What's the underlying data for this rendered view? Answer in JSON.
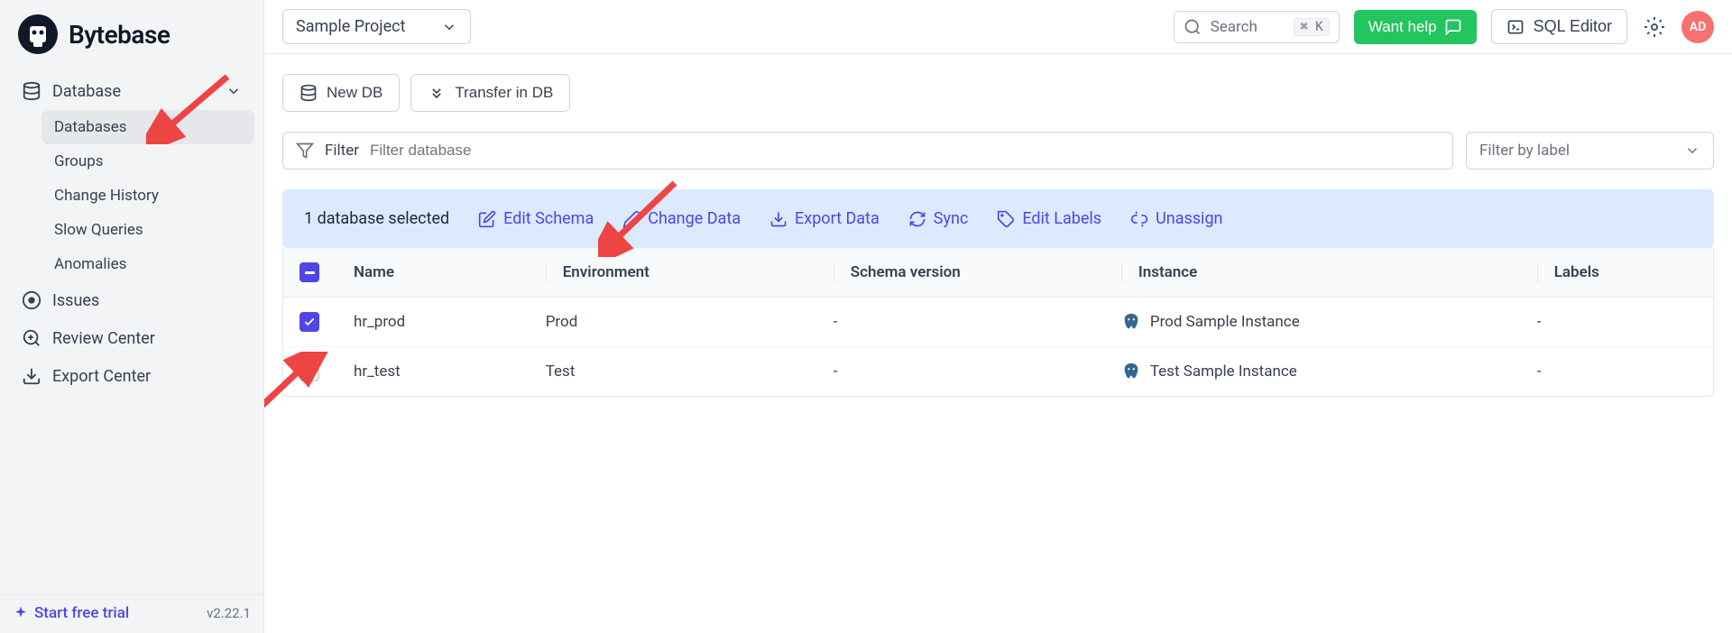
{
  "brand": "Bytebase",
  "sidebar": {
    "database_group": "Database",
    "items": [
      "Databases",
      "Groups",
      "Change History",
      "Slow Queries",
      "Anomalies"
    ],
    "issues": "Issues",
    "review_center": "Review Center",
    "export_center": "Export Center"
  },
  "footer": {
    "trial": "Start free trial",
    "version": "v2.22.1"
  },
  "topbar": {
    "project": "Sample Project",
    "search_placeholder": "Search",
    "search_kbd": "⌘ K",
    "help": "Want help",
    "sql_editor": "SQL Editor",
    "avatar": "AD"
  },
  "actions": {
    "new_db": "New DB",
    "transfer": "Transfer in DB"
  },
  "filters": {
    "label": "Filter",
    "placeholder": "Filter database",
    "by_label": "Filter by label"
  },
  "selection": {
    "count_text": "1 database selected",
    "edit_schema": "Edit Schema",
    "change_data": "Change Data",
    "export_data": "Export Data",
    "sync": "Sync",
    "edit_labels": "Edit Labels",
    "unassign": "Unassign"
  },
  "table": {
    "headers": {
      "name": "Name",
      "environment": "Environment",
      "schema_version": "Schema version",
      "instance": "Instance",
      "labels": "Labels"
    },
    "rows": [
      {
        "checked": true,
        "name": "hr_prod",
        "environment": "Prod",
        "schema_version": "-",
        "instance": "Prod Sample Instance",
        "labels": "-"
      },
      {
        "checked": false,
        "name": "hr_test",
        "environment": "Test",
        "schema_version": "-",
        "instance": "Test Sample Instance",
        "labels": "-"
      }
    ]
  }
}
